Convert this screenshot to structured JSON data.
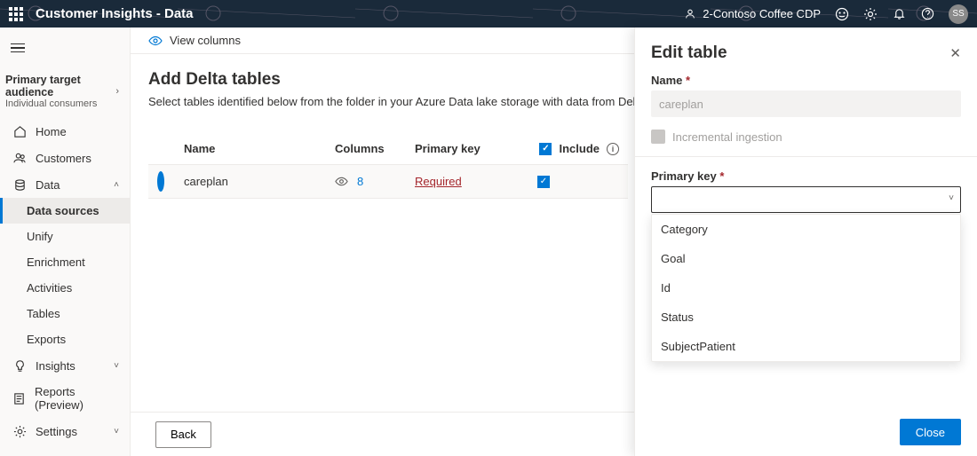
{
  "topbar": {
    "app_title": "Customer Insights - Data",
    "environment": "2-Contoso Coffee CDP",
    "avatar_initials": "SS"
  },
  "sidebar": {
    "audience_title": "Primary target audience",
    "audience_subtitle": "Individual consumers",
    "items": {
      "home": "Home",
      "customers": "Customers",
      "data": "Data",
      "data_sources": "Data sources",
      "unify": "Unify",
      "enrichment": "Enrichment",
      "activities": "Activities",
      "tables": "Tables",
      "exports": "Exports",
      "insights": "Insights",
      "reports": "Reports (Preview)",
      "settings": "Settings"
    }
  },
  "cmdbar": {
    "view_columns": "View columns"
  },
  "page": {
    "title": "Add Delta tables",
    "subtitle": "Select tables identified below from the folder in your Azure Data lake storage with data from Delta tables."
  },
  "table": {
    "headers": {
      "name": "Name",
      "columns": "Columns",
      "primary_key": "Primary key",
      "include": "Include"
    },
    "rows": [
      {
        "name": "careplan",
        "columns": "8",
        "primary_key": "Required",
        "included": true
      }
    ]
  },
  "footer": {
    "back": "Back"
  },
  "panel": {
    "title": "Edit table",
    "name_label": "Name",
    "name_value": "careplan",
    "incremental_label": "Incremental ingestion",
    "primary_key_label": "Primary key",
    "primary_key_value": "",
    "options": [
      "Category",
      "Goal",
      "Id",
      "Status",
      "SubjectPatient"
    ],
    "close": "Close"
  }
}
